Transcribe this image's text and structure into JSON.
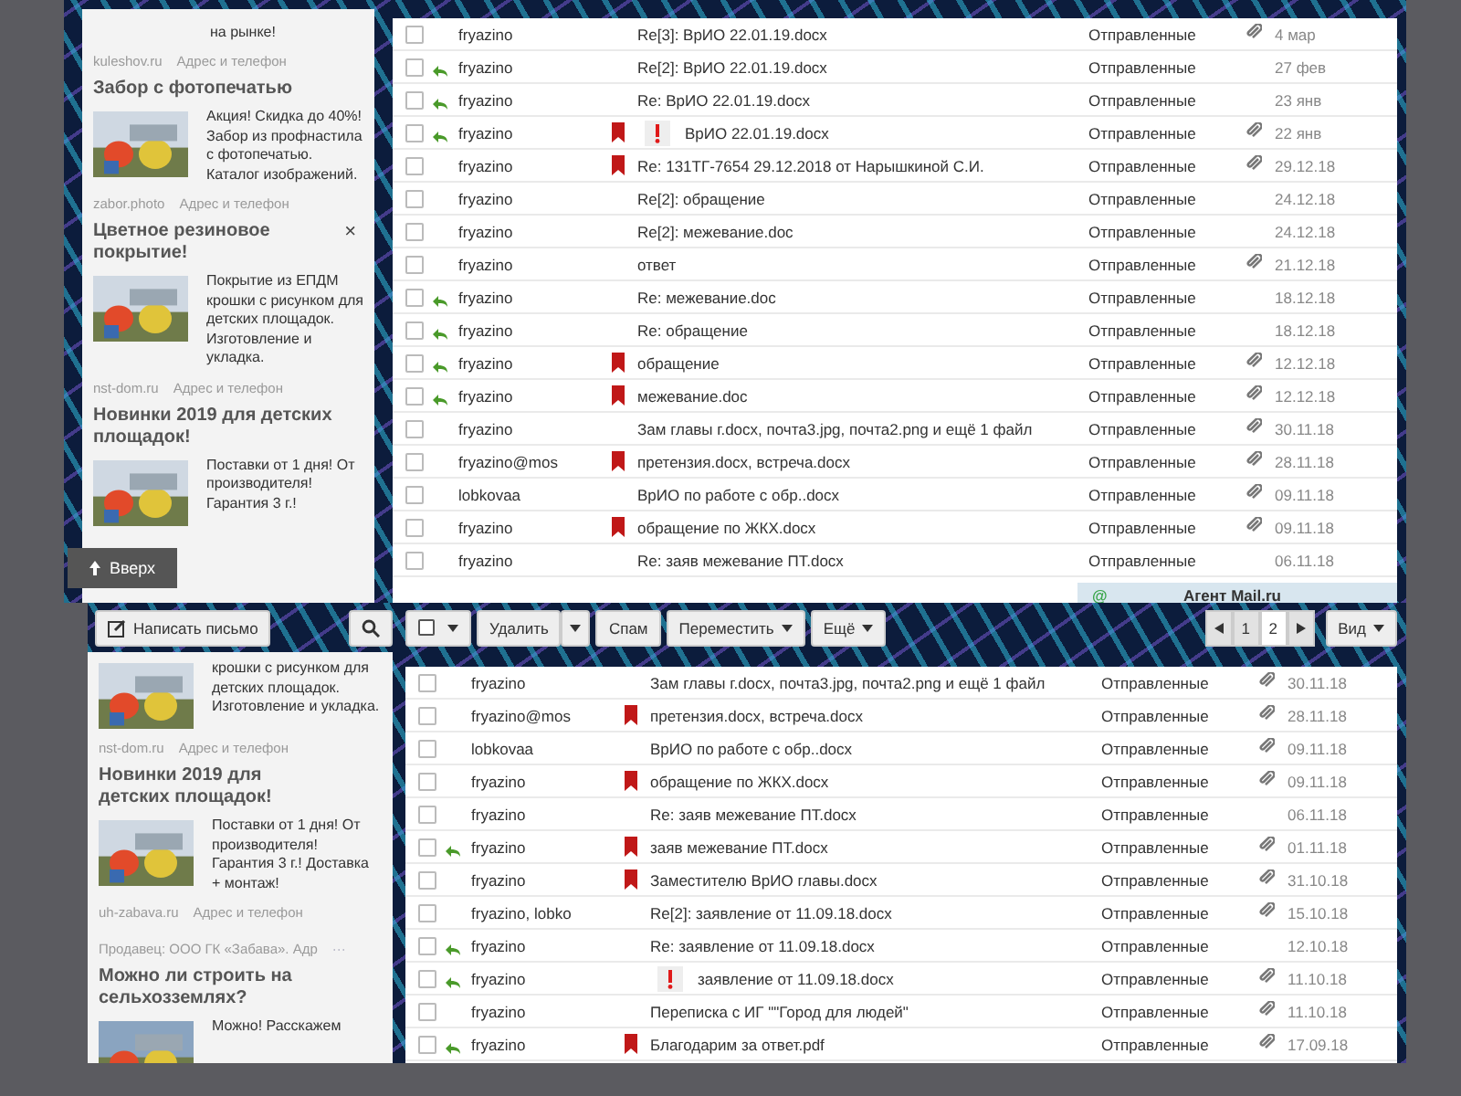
{
  "panels": [
    {
      "sidebar": {
        "items": [
          {
            "kind": "lead",
            "text": "на рынке!"
          },
          {
            "kind": "source",
            "domain": "kuleshov.ru",
            "link": "Адрес и телефон"
          },
          {
            "kind": "ad",
            "title": "Забор с фотопечатью",
            "text": "Акция! Скидка до 40%! Забор из профнастила с фотопечатью. Каталог изображений."
          },
          {
            "kind": "source",
            "domain": "zabor.photo",
            "link": "Адрес и телефон"
          },
          {
            "kind": "ad",
            "title": "Цветное резиновое покрытие!",
            "close": "×",
            "text": "Покрытие из ЕПДМ крошки с рисунком для детских площадок. Изготовление и укладка."
          },
          {
            "kind": "source",
            "domain": "nst-dom.ru",
            "link": "Адрес и телефон"
          },
          {
            "kind": "ad",
            "title": "Новинки 2019 для детских площадок!",
            "text": "Поставки от 1 дня! От производителя! Гарантия 3 г.!"
          }
        ]
      },
      "scroll_up_button": {
        "label": "Вверх"
      },
      "messages": [
        {
          "checked": false,
          "sender": "fryazino",
          "replied": false,
          "flagged": false,
          "important": false,
          "subject": "Re[3]: ВрИО 22.01.19.docx",
          "folder": "Отправленные",
          "attachment": true,
          "date": "4 мар"
        },
        {
          "checked": false,
          "sender": "fryazino",
          "replied": true,
          "flagged": false,
          "important": false,
          "subject": "Re[2]: ВрИО 22.01.19.docx",
          "folder": "Отправленные",
          "attachment": false,
          "date": "27 фев"
        },
        {
          "checked": false,
          "sender": "fryazino",
          "replied": true,
          "flagged": false,
          "important": false,
          "subject": "Re: ВрИО 22.01.19.docx",
          "folder": "Отправленные",
          "attachment": false,
          "date": "23 янв"
        },
        {
          "checked": false,
          "sender": "fryazino",
          "replied": true,
          "flagged": true,
          "important": true,
          "subject": "ВрИО 22.01.19.docx",
          "folder": "Отправленные",
          "attachment": true,
          "date": "22 янв"
        },
        {
          "checked": false,
          "sender": "fryazino",
          "replied": false,
          "flagged": true,
          "important": false,
          "subject": "Re: 131ТГ-7654 29.12.2018 от Нарышкиной С.И.",
          "folder": "Отправленные",
          "attachment": true,
          "date": "29.12.18"
        },
        {
          "checked": false,
          "sender": "fryazino",
          "replied": false,
          "flagged": false,
          "important": false,
          "subject": "Re[2]: обращение",
          "folder": "Отправленные",
          "attachment": false,
          "date": "24.12.18"
        },
        {
          "checked": false,
          "sender": "fryazino",
          "replied": false,
          "flagged": false,
          "important": false,
          "subject": "Re[2]: межевание.doc",
          "folder": "Отправленные",
          "attachment": false,
          "date": "24.12.18"
        },
        {
          "checked": false,
          "sender": "fryazino",
          "replied": false,
          "flagged": false,
          "important": false,
          "subject": "ответ",
          "folder": "Отправленные",
          "attachment": true,
          "date": "21.12.18"
        },
        {
          "checked": false,
          "sender": "fryazino",
          "replied": true,
          "flagged": false,
          "important": false,
          "subject": "Re: межевание.doc",
          "folder": "Отправленные",
          "attachment": false,
          "date": "18.12.18"
        },
        {
          "checked": false,
          "sender": "fryazino",
          "replied": true,
          "flagged": false,
          "important": false,
          "subject": "Re: обращение",
          "folder": "Отправленные",
          "attachment": false,
          "date": "18.12.18"
        },
        {
          "checked": false,
          "sender": "fryazino",
          "replied": true,
          "flagged": true,
          "important": false,
          "subject": "обращение",
          "folder": "Отправленные",
          "attachment": true,
          "date": "12.12.18"
        },
        {
          "checked": false,
          "sender": "fryazino",
          "replied": true,
          "flagged": true,
          "important": false,
          "subject": "межевание.doc",
          "folder": "Отправленные",
          "attachment": true,
          "date": "12.12.18"
        },
        {
          "checked": false,
          "sender": "fryazino",
          "replied": false,
          "flagged": false,
          "important": false,
          "subject": "Зам главы г.docx, почта3.jpg, почта2.png и ещё 1 файл",
          "folder": "Отправленные",
          "attachment": true,
          "date": "30.11.18"
        },
        {
          "checked": false,
          "sender": "fryazino@mos",
          "replied": false,
          "flagged": true,
          "important": false,
          "subject": "претензия.docx, встреча.docx",
          "folder": "Отправленные",
          "attachment": true,
          "date": "28.11.18"
        },
        {
          "checked": false,
          "sender": "lobkovaa",
          "replied": false,
          "flagged": false,
          "important": false,
          "subject": "ВрИО по работе с обр..docx",
          "folder": "Отправленные",
          "attachment": true,
          "date": "09.11.18"
        },
        {
          "checked": false,
          "sender": "fryazino",
          "replied": false,
          "flagged": true,
          "important": false,
          "subject": "обращение по ЖКХ.docx",
          "folder": "Отправленные",
          "attachment": true,
          "date": "09.11.18"
        },
        {
          "checked": false,
          "sender": "fryazino",
          "replied": false,
          "flagged": false,
          "important": false,
          "subject": "Re: заяв межевание ПТ.docx",
          "folder": "Отправленные",
          "attachment": false,
          "date": "06.11.18"
        }
      ],
      "agent_bar": {
        "icon": "@",
        "label": "Агент Mail.ru"
      }
    },
    {
      "toolbar": {
        "compose": "Написать письмо",
        "delete": "Удалить",
        "spam": "Спам",
        "move": "Переместить",
        "more": "Ещё",
        "pages": [
          {
            "label": "1",
            "selected": false
          },
          {
            "label": "2",
            "selected": true
          }
        ],
        "view": "Вид"
      },
      "sidebar": {
        "items": [
          {
            "kind": "ad",
            "text": "крошки с рисунком для детских площадок. Изготовление и укладка."
          },
          {
            "kind": "source",
            "domain": "nst-dom.ru",
            "link": "Адрес и телефон"
          },
          {
            "kind": "ad",
            "title": "Новинки 2019 для детских площадок!",
            "text": "Поставки от 1 дня! От производителя! Гарантия 3 г.! Доставка + монтаж!"
          },
          {
            "kind": "source",
            "domain": "uh-zabava.ru",
            "link": "Адрес и телефон"
          },
          {
            "kind": "seller",
            "text": "Продавец: ООО ГК «Забава». Адр",
            "more": "···"
          },
          {
            "kind": "ad",
            "title": "Можно ли строить на сельхозземлях?",
            "text": "Можно! Расскажем"
          }
        ]
      },
      "messages": [
        {
          "checked": false,
          "sender": "fryazino",
          "replied": false,
          "flagged": false,
          "important": false,
          "subject": "Зам главы г.docx, почта3.jpg, почта2.png и ещё 1 файл",
          "folder": "Отправленные",
          "attachment": true,
          "date": "30.11.18"
        },
        {
          "checked": false,
          "sender": "fryazino@mos",
          "replied": false,
          "flagged": true,
          "important": false,
          "subject": "претензия.docx, встреча.docx",
          "folder": "Отправленные",
          "attachment": true,
          "date": "28.11.18"
        },
        {
          "checked": false,
          "sender": "lobkovaa",
          "replied": false,
          "flagged": false,
          "important": false,
          "subject": "ВрИО по работе с обр..docx",
          "folder": "Отправленные",
          "attachment": true,
          "date": "09.11.18"
        },
        {
          "checked": false,
          "sender": "fryazino",
          "replied": false,
          "flagged": true,
          "important": false,
          "subject": "обращение по ЖКХ.docx",
          "folder": "Отправленные",
          "attachment": true,
          "date": "09.11.18"
        },
        {
          "checked": false,
          "sender": "fryazino",
          "replied": false,
          "flagged": false,
          "important": false,
          "subject": "Re: заяв межевание ПТ.docx",
          "folder": "Отправленные",
          "attachment": false,
          "date": "06.11.18"
        },
        {
          "checked": false,
          "sender": "fryazino",
          "replied": true,
          "flagged": true,
          "important": false,
          "subject": "заяв межевание ПТ.docx",
          "folder": "Отправленные",
          "attachment": true,
          "date": "01.11.18"
        },
        {
          "checked": false,
          "sender": "fryazino",
          "replied": false,
          "flagged": true,
          "important": false,
          "subject": "Заместителю ВрИО главы.docx",
          "folder": "Отправленные",
          "attachment": true,
          "date": "31.10.18"
        },
        {
          "checked": false,
          "sender": "fryazino, lobko",
          "replied": false,
          "flagged": false,
          "important": false,
          "subject": "Re[2]: заявление от 11.09.18.docx",
          "folder": "Отправленные",
          "attachment": true,
          "date": "15.10.18"
        },
        {
          "checked": false,
          "sender": "fryazino",
          "replied": true,
          "flagged": false,
          "important": false,
          "subject": "Re: заявление от 11.09.18.docx",
          "folder": "Отправленные",
          "attachment": false,
          "date": "12.10.18"
        },
        {
          "checked": false,
          "sender": "fryazino",
          "replied": true,
          "flagged": false,
          "important": true,
          "subject": "заявление от 11.09.18.docx",
          "folder": "Отправленные",
          "attachment": true,
          "date": "11.10.18"
        },
        {
          "checked": false,
          "sender": "fryazino",
          "replied": false,
          "flagged": false,
          "important": false,
          "subject": "Переписка с ИГ \"\"Город для людей\"",
          "folder": "Отправленные",
          "attachment": true,
          "date": "11.10.18"
        },
        {
          "checked": false,
          "sender": "fryazino",
          "replied": true,
          "flagged": true,
          "important": false,
          "subject": "Благодарим за ответ.pdf",
          "folder": "Отправленные",
          "attachment": true,
          "date": "17.09.18"
        }
      ]
    }
  ]
}
